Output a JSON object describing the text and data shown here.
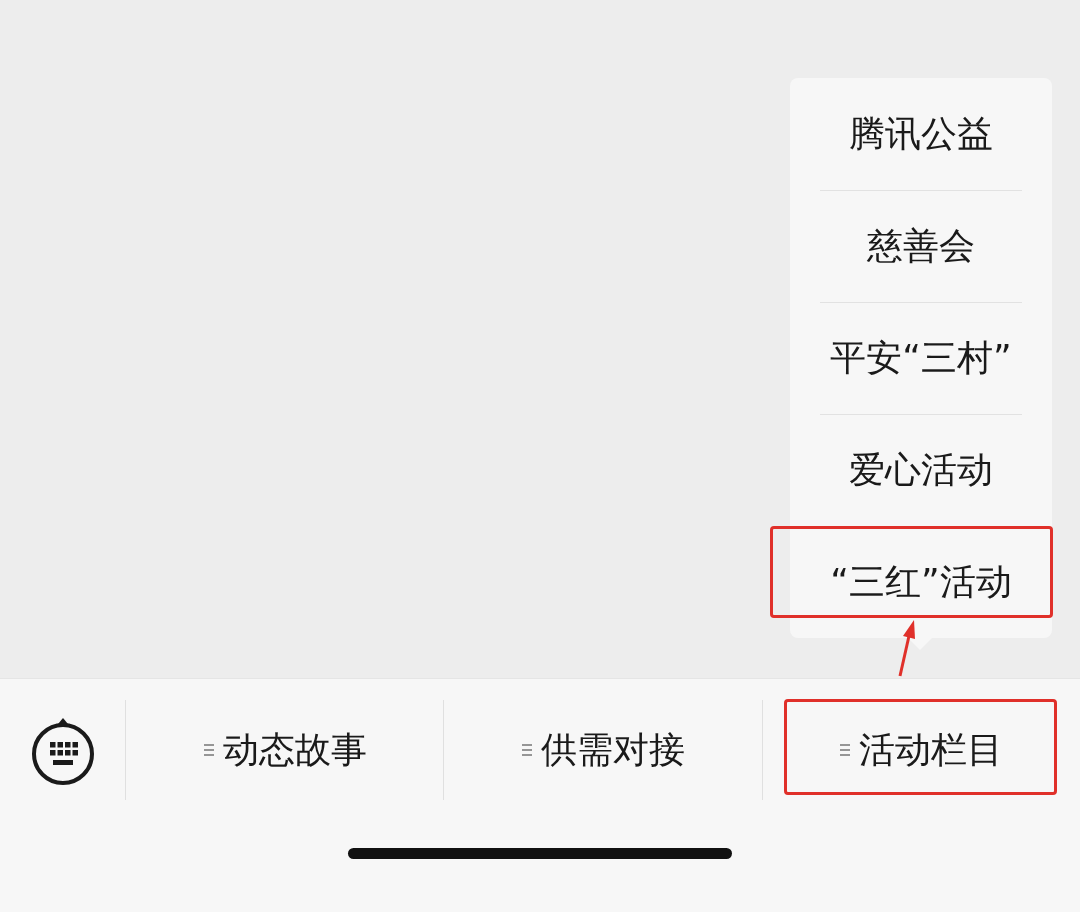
{
  "submenu": [
    {
      "label": "腾讯公益",
      "highlighted": false
    },
    {
      "label": "慈善会",
      "highlighted": false
    },
    {
      "label": "平安“三村”",
      "highlighted": false
    },
    {
      "label": "爱心活动",
      "highlighted": false
    },
    {
      "label": "“三红”活动",
      "highlighted": true
    }
  ],
  "menu": [
    {
      "label": "动态故事",
      "highlighted": false
    },
    {
      "label": "供需对接",
      "highlighted": false
    },
    {
      "label": "活动栏目",
      "highlighted": true
    }
  ]
}
